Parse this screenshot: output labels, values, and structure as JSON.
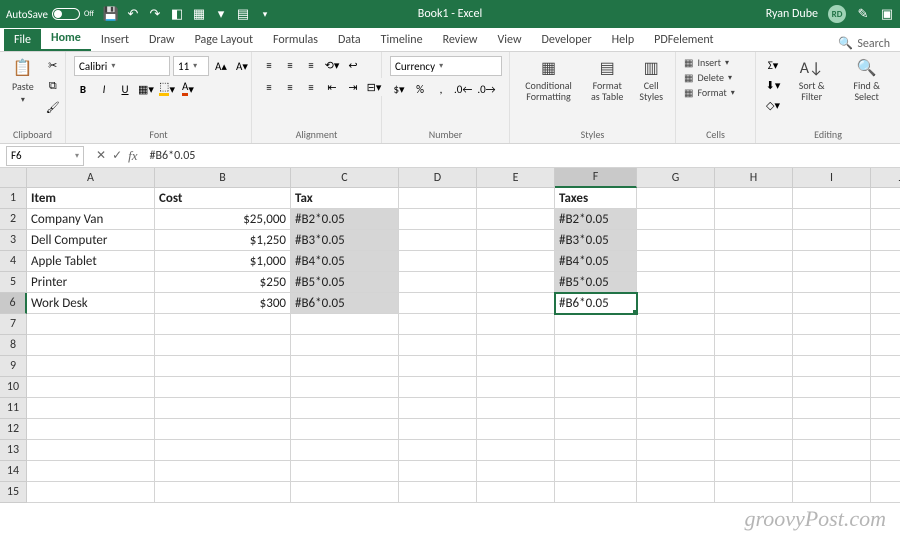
{
  "titlebar": {
    "autosave_label": "AutoSave",
    "autosave_state": "Off",
    "title": "Book1 - Excel",
    "user_name": "Ryan Dube",
    "user_initials": "RD"
  },
  "tabs": [
    "File",
    "Home",
    "Insert",
    "Draw",
    "Page Layout",
    "Formulas",
    "Data",
    "Timeline",
    "Review",
    "View",
    "Developer",
    "Help",
    "PDFelement"
  ],
  "active_tab_index": 1,
  "search_placeholder": "Search",
  "ribbon": {
    "clipboard": {
      "label": "Clipboard",
      "paste": "Paste"
    },
    "font": {
      "label": "Font",
      "name": "Calibri",
      "size": "11",
      "buttons": {
        "bold": "B",
        "italic": "I",
        "underline": "U"
      }
    },
    "alignment": {
      "label": "Alignment",
      "wrap": ""
    },
    "number": {
      "label": "Number",
      "format": "Currency"
    },
    "styles": {
      "label": "Styles",
      "conditional": "Conditional Formatting",
      "table": "Format as Table",
      "cell": "Cell Styles"
    },
    "cells": {
      "label": "Cells",
      "insert": "Insert",
      "delete": "Delete",
      "format": "Format"
    },
    "editing": {
      "label": "Editing",
      "sort": "Sort & Filter",
      "find": "Find & Select"
    }
  },
  "formula_bar": {
    "name_box": "F6",
    "formula": "#B6*0.05"
  },
  "columns": [
    {
      "letter": "A",
      "w": 128
    },
    {
      "letter": "B",
      "w": 136
    },
    {
      "letter": "C",
      "w": 108
    },
    {
      "letter": "D",
      "w": 78
    },
    {
      "letter": "E",
      "w": 78
    },
    {
      "letter": "F",
      "w": 82
    },
    {
      "letter": "G",
      "w": 78
    },
    {
      "letter": "H",
      "w": 78
    },
    {
      "letter": "I",
      "w": 78
    },
    {
      "letter": "J",
      "w": 60
    }
  ],
  "row_numbers": [
    1,
    2,
    3,
    4,
    5,
    6,
    7,
    8,
    9,
    10,
    11,
    12,
    13,
    14,
    15
  ],
  "chart_data": {
    "type": "table",
    "headers": {
      "A": "Item",
      "B": "Cost",
      "C": "Tax",
      "F": "Taxes"
    },
    "rows": [
      {
        "A": "Company Van",
        "B": "$25,000",
        "C": "#B2*0.05",
        "F": "#B2*0.05"
      },
      {
        "A": "Dell Computer",
        "B": "$1,250",
        "C": "#B3*0.05",
        "F": "#B3*0.05"
      },
      {
        "A": "Apple Tablet",
        "B": "$1,000",
        "C": "#B4*0.05",
        "F": "#B4*0.05"
      },
      {
        "A": "Printer",
        "B": "$250",
        "C": "#B5*0.05",
        "F": "#B5*0.05"
      },
      {
        "A": "Work Desk",
        "B": "$300",
        "C": "#B6*0.05",
        "F": "#B6*0.05"
      }
    ]
  },
  "watermark": "groovyPost.com"
}
